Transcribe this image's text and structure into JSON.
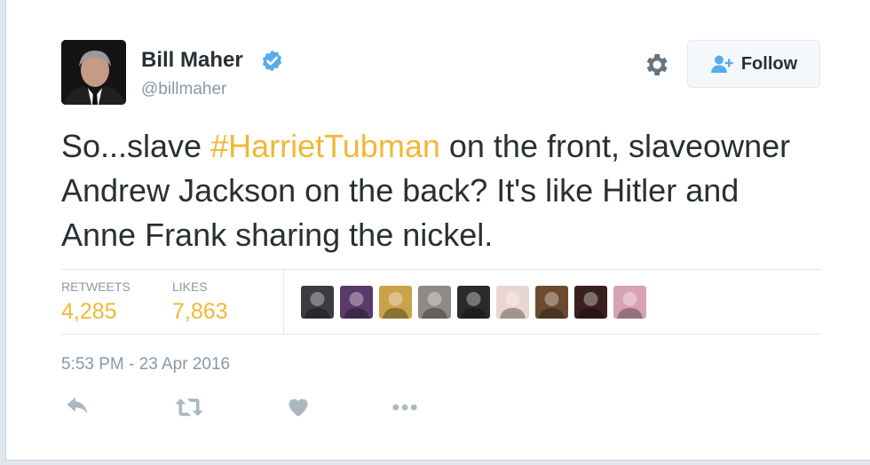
{
  "author": {
    "name": "Bill Maher",
    "handle": "@billmaher",
    "verified": true
  },
  "follow_button": {
    "label": "Follow",
    "icon": "add-user-icon"
  },
  "settings": {
    "icon": "gear-icon"
  },
  "tweet": {
    "text_before": "So...slave ",
    "hashtag": "#HarrietTubman",
    "text_after": " on the front, slaveowner Andrew Jackson on the back? It's like Hitler and Anne Frank sharing the nickel."
  },
  "stats": {
    "retweets_label": "RETWEETS",
    "retweets_value": "4,285",
    "likes_label": "LIKES",
    "likes_value": "7,863"
  },
  "likers": [
    {
      "icon": "user-avatar",
      "color": "#3d3a42"
    },
    {
      "icon": "user-avatar",
      "color": "#5a3a6b"
    },
    {
      "icon": "user-avatar",
      "color": "#c9a24a"
    },
    {
      "icon": "user-avatar",
      "color": "#8e8a86"
    },
    {
      "icon": "user-avatar",
      "color": "#2a2a2a"
    },
    {
      "icon": "user-avatar",
      "color": "#e9d6cf"
    },
    {
      "icon": "user-avatar",
      "color": "#6b4a2e"
    },
    {
      "icon": "user-avatar",
      "color": "#3a1f1f"
    },
    {
      "icon": "user-avatar",
      "color": "#d7a3b4"
    }
  ],
  "timestamp": "5:53 PM - 23 Apr 2016",
  "actions": [
    "reply-icon",
    "retweet-icon",
    "like-icon",
    "more-icon"
  ],
  "colors": {
    "accent": "#f2b736",
    "verified_blue": "#55acee",
    "muted": "#8899a6",
    "text": "#292f33"
  }
}
